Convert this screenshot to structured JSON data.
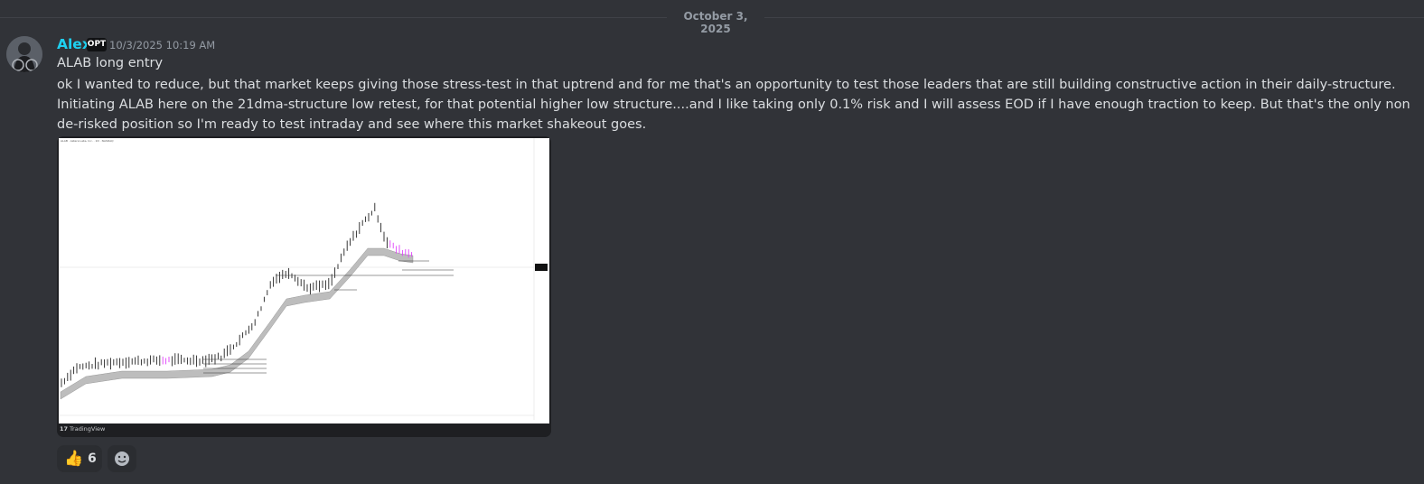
{
  "date_divider": "October 3, 2025",
  "message": {
    "author": "Alex",
    "author_tag": "OPT",
    "timestamp": "10/3/2025 10:19 AM",
    "title": "ALAB long entry",
    "body": "ok I wanted to reduce, but that market keeps giving those stress-test in that uptrend and for me that's an opportunity to test those leaders that are still building constructive action in their daily-structure. Initiating ALAB here on the 21dma-structure low retest, for that potential higher low structure....and I like taking only 0.1% risk and I will assess EOD if I have enough traction to keep. But that's the only non de-risked position so I'm ready to test intraday and see where this market shakeout goes."
  },
  "embed": {
    "provider": "TradingView",
    "chart_header": "ALAB · Astera Labs, Inc. · 1D · NASDAQ"
  },
  "reactions": [
    {
      "emoji": "👍",
      "count": "6"
    }
  ],
  "colors": {
    "background": "#313338",
    "username": "#1ed0f0",
    "text": "#dbdee1",
    "muted": "#949ba4",
    "candle": "#222222",
    "candle_highlight": "#e040fb",
    "ma_band": "#bdbdbd"
  },
  "icons": {
    "avatar": "avatar-image",
    "add_reaction": "smiley-icon",
    "tradingview": "tradingview-logo-icon"
  }
}
